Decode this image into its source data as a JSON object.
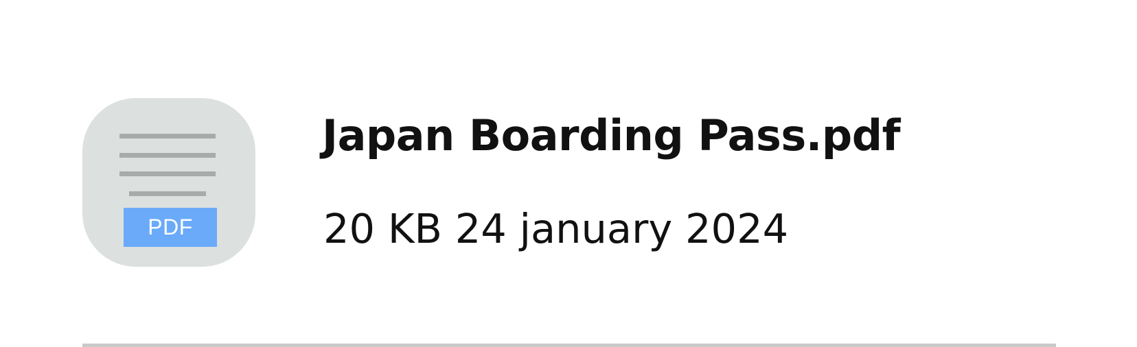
{
  "file": {
    "name": "Japan Boarding Pass.pdf",
    "size": "20 KB",
    "date": "24 january 2024",
    "type_badge": "PDF",
    "icon": "pdf-file-icon"
  },
  "colors": {
    "icon_background": "#dce0df",
    "icon_lines": "#a8abaa",
    "badge_background": "#6aaaf9",
    "text": "#111111",
    "divider": "#c9c9c9"
  }
}
